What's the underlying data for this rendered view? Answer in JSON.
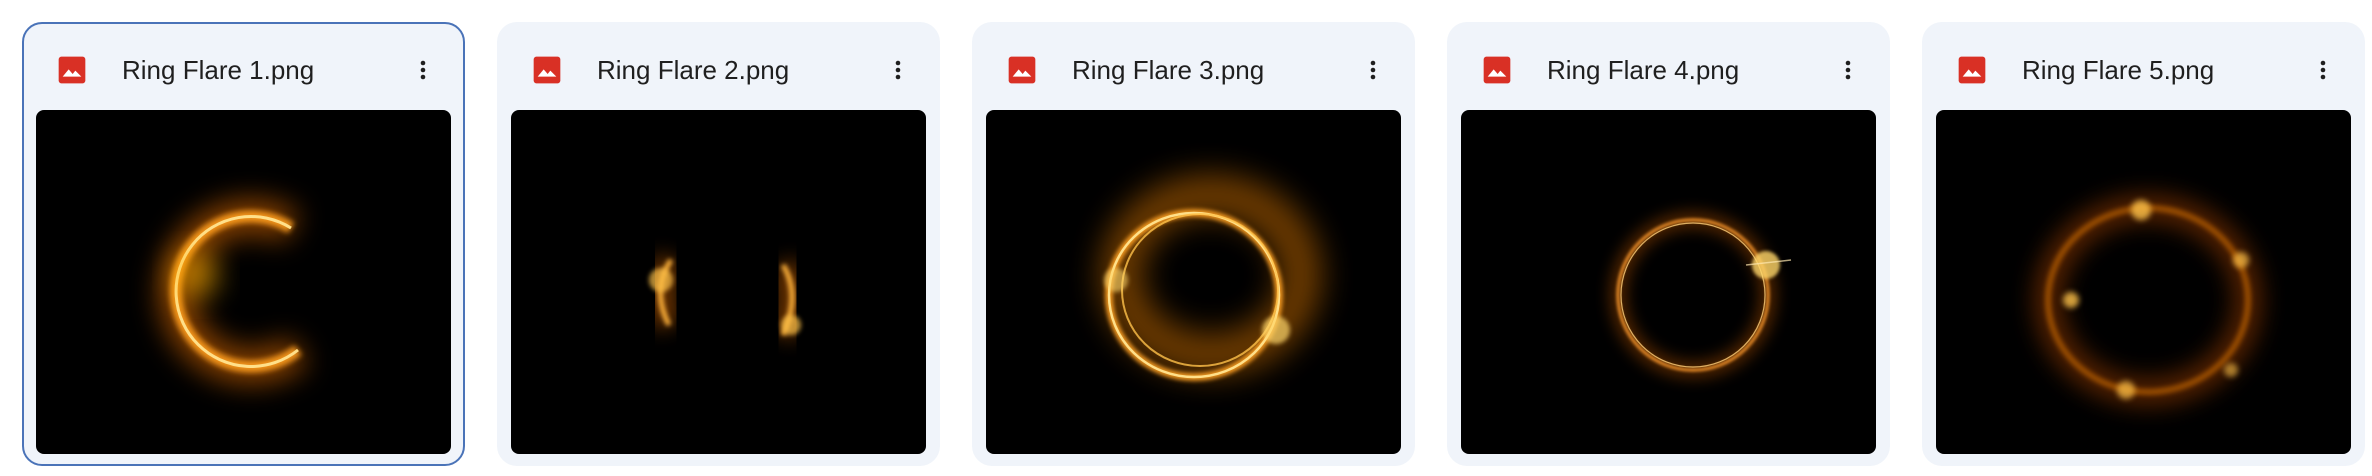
{
  "files": [
    {
      "name": "Ring Flare 1.png",
      "selected": true
    },
    {
      "name": "Ring Flare 2.png",
      "selected": false
    },
    {
      "name": "Ring Flare 3.png",
      "selected": false
    },
    {
      "name": "Ring Flare 4.png",
      "selected": false
    },
    {
      "name": "Ring Flare 5.png",
      "selected": false
    }
  ],
  "colors": {
    "card_bg": "#f0f4fa",
    "selected_border": "#4a73b8",
    "image_icon": "#d93025",
    "flare_core": "#ffd76a",
    "flare_glow": "#ff8a00"
  },
  "icons": {
    "file_type": "image-icon",
    "more": "more-vert-icon"
  }
}
